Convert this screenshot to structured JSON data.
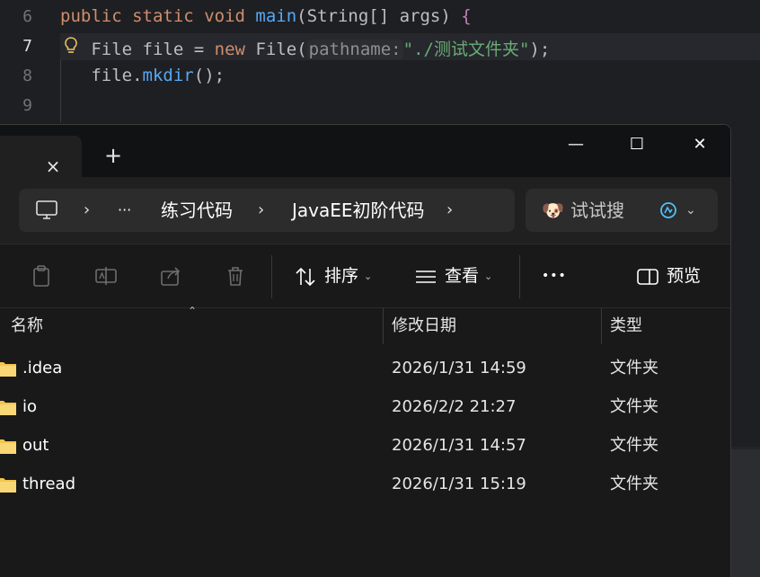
{
  "editor": {
    "line_numbers": [
      "6",
      "7",
      "8",
      "9"
    ],
    "line6": {
      "kw1": "public",
      "kw2": "static",
      "kw3": "void",
      "fn": "main",
      "paren_open": "(",
      "type": "String[]",
      "param": "args",
      "paren_close": ")",
      "brace": "{"
    },
    "line7": {
      "type": "File",
      "var": "file",
      "eq": "=",
      "kw": "new",
      "cls": "File",
      "open": "(",
      "hint": "pathname:",
      "str": "\"./测试文件夹\"",
      "close": ");"
    },
    "line8": {
      "obj": "file",
      "dot": ".",
      "method": "mkdir",
      "call": "();"
    }
  },
  "explorer": {
    "tab": {
      "close_icon": "×",
      "new_tab_icon": "+"
    },
    "window_controls": {
      "minimize": "—",
      "maximize": "☐",
      "close": "✕"
    },
    "address": {
      "sep1": "›",
      "ellipsis": "···",
      "crumb1": "练习代码",
      "sep2": "›",
      "crumb2": "JavaEE初阶代码",
      "sep3": "›"
    },
    "search": {
      "emoji": "🐶",
      "label": "试试搜",
      "chevron": "⌄"
    },
    "toolbar": {
      "sort": "排序",
      "view": "查看",
      "more": "•••",
      "preview": "预览",
      "dropdown": "⌄"
    },
    "columns": {
      "name": "名称",
      "modified": "修改日期",
      "type": "类型",
      "sort_caret": "⌃"
    },
    "files": [
      {
        "name": ".idea",
        "modified": "2026/1/31 14:59",
        "type": "文件夹"
      },
      {
        "name": "io",
        "modified": "2026/2/2 21:27",
        "type": "文件夹"
      },
      {
        "name": "out",
        "modified": "2026/1/31 14:57",
        "type": "文件夹"
      },
      {
        "name": "thread",
        "modified": "2026/1/31 15:19",
        "type": "文件夹"
      }
    ],
    "colors": {
      "folder": "#f3c64a",
      "accent": "#4cc2ff"
    }
  }
}
